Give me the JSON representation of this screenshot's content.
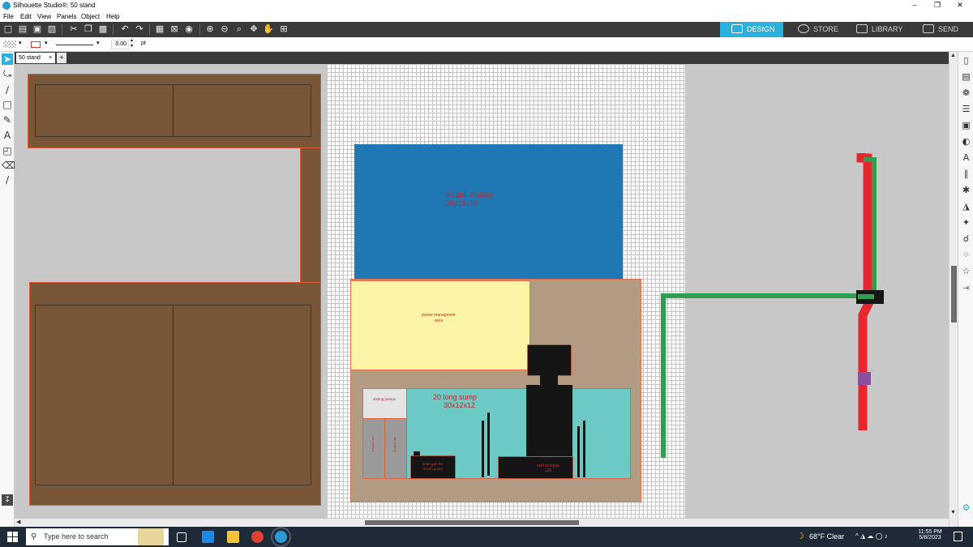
{
  "window": {
    "title": "Silhouette Studio®: 50 stand",
    "controls": [
      "–",
      "❐",
      "✕"
    ]
  },
  "menu": [
    "File",
    "Edit",
    "View",
    "Panels",
    "Object",
    "Help"
  ],
  "modes": {
    "design": "DESIGN",
    "store": "STORE",
    "library": "LIBRARY",
    "send": "SEND"
  },
  "line_style": {
    "width_value": "0.00",
    "unit": "pt"
  },
  "document_tab": {
    "name": "50 stand",
    "close": "×",
    "add": "+"
  },
  "design": {
    "colors": {
      "wood": "#7a5639",
      "wood_outline": "#e05a3a",
      "display_tank": "#1f78b4",
      "stand_back": "#b39a82",
      "power_area": "#fbf5a5",
      "sump": "#6cc9c4",
      "equipment": "#151515",
      "dosing": "#e4e4e4",
      "reservoir": "#9a9a9a",
      "drain_pipe": "#2ea04d",
      "return_pipe": "#e8262e",
      "valve": "#8e4fa0"
    },
    "display_tank_label": "50 gal. display",
    "display_tank_size": "36x18x18",
    "power_area_label": "power managment",
    "power_area_label2": "area",
    "sump_label": "20 long sump",
    "sump_size": "30x12x12",
    "dosing_label": "dosing pumps",
    "reservoir_1_label": "ato reservoir",
    "reservoir_2_label": "ato reservoir",
    "return_pump_label": "1000 gph DC",
    "return_pump_label2": "return pump",
    "skimmer_label": "reef octopus",
    "skimmer_label2": "120"
  },
  "taskbar": {
    "search_placeholder": "Type here to search",
    "weather": "68°F  Clear",
    "time": "11:55 PM",
    "date": "5/8/2023"
  }
}
